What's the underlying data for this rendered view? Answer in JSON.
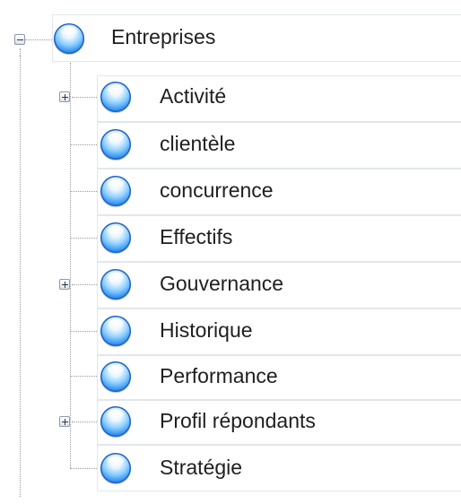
{
  "tree": {
    "root": {
      "label": "Entreprises",
      "expanded": true,
      "icon": "globe-node-icon"
    },
    "children": [
      {
        "label": "Activité",
        "expandable": true
      },
      {
        "label": "clientèle",
        "expandable": false
      },
      {
        "label": "concurrence",
        "expandable": false
      },
      {
        "label": "Effectifs",
        "expandable": false
      },
      {
        "label": "Gouvernance",
        "expandable": true
      },
      {
        "label": "Historique",
        "expandable": false
      },
      {
        "label": "Performance",
        "expandable": false
      },
      {
        "label": "Profil répondants",
        "expandable": true
      },
      {
        "label": "Stratégie",
        "expandable": false
      }
    ]
  },
  "colors": {
    "node_icon": "#2a8df0",
    "connector": "#9a9a9a",
    "row_border": "#e3e6ea",
    "text": "#1f1f1f"
  }
}
